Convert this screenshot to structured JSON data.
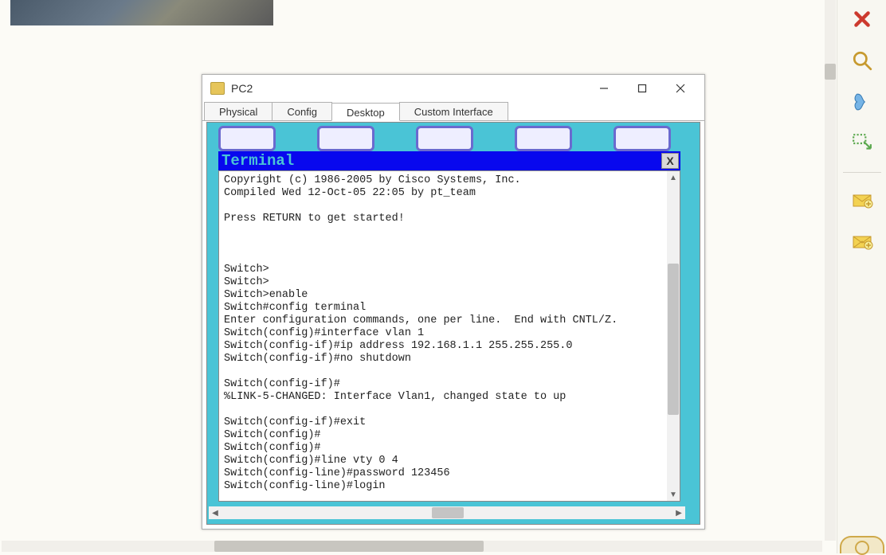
{
  "window": {
    "title": "PC2",
    "tabs": {
      "physical": "Physical",
      "config": "Config",
      "desktop": "Desktop",
      "custom": "Custom Interface"
    }
  },
  "terminal": {
    "title": "Terminal",
    "close": "X",
    "lines": "Copyright (c) 1986-2005 by Cisco Systems, Inc.\nCompiled Wed 12-Oct-05 22:05 by pt_team\n\nPress RETURN to get started!\n\n\n\nSwitch>\nSwitch>\nSwitch>enable\nSwitch#config terminal\nEnter configuration commands, one per line.  End with CNTL/Z.\nSwitch(config)#interface vlan 1\nSwitch(config-if)#ip address 192.168.1.1 255.255.255.0\nSwitch(config-if)#no shutdown\n\nSwitch(config-if)#\n%LINK-5-CHANGED: Interface Vlan1, changed state to up\n\nSwitch(config-if)#exit\nSwitch(config)#\nSwitch(config)#\nSwitch(config)#line vty 0 4\nSwitch(config-line)#password 123456\nSwitch(config-line)#login"
  },
  "sidebar": {
    "delete": "delete",
    "zoom": "magnify",
    "puzzle": "place-note",
    "marquee": "resize",
    "envelope": "add-simple-pdu",
    "envelope2": "add-complex-pdu"
  }
}
